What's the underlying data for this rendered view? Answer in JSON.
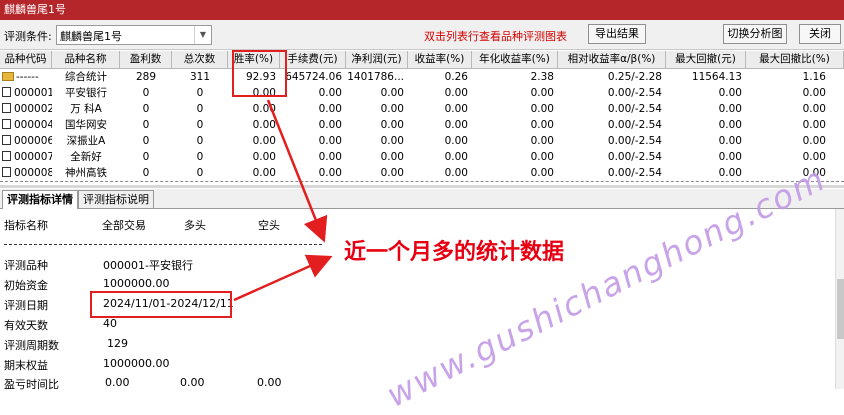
{
  "window": {
    "title": "麒麟兽尾1号"
  },
  "toolbar": {
    "label": "评测条件:",
    "condition_value": "麒麟兽尾1号",
    "hint": "双击列表行查看品种评测图表",
    "export_label": "导出结果",
    "switch_label": "切换分析图",
    "close_label": "关闭"
  },
  "table": {
    "columns": [
      "品种代码",
      "品种名称",
      "盈利数",
      "总次数",
      "胜率(%)",
      "手续费(元)",
      "净利润(元)",
      "收益率(%)",
      "年化收益率(%)",
      "相对收益率α/β(%)",
      "最大回撤(元)",
      "最大回撤比(%)"
    ],
    "summary": [
      "------",
      "综合统计",
      "289",
      "311",
      "92.93",
      "645724.06",
      "1401786...",
      "0.26",
      "2.38",
      "0.25/-2.28",
      "11564.13",
      "1.16"
    ],
    "rows": [
      [
        "000001",
        "平安银行",
        "0",
        "0",
        "0.00",
        "0.00",
        "0.00",
        "0.00",
        "0.00",
        "0.00/-2.54",
        "0.00",
        "0.00"
      ],
      [
        "000002",
        "万 科A",
        "0",
        "0",
        "0.00",
        "0.00",
        "0.00",
        "0.00",
        "0.00",
        "0.00/-2.54",
        "0.00",
        "0.00"
      ],
      [
        "000004",
        "国华网安",
        "0",
        "0",
        "0.00",
        "0.00",
        "0.00",
        "0.00",
        "0.00",
        "0.00/-2.54",
        "0.00",
        "0.00"
      ],
      [
        "000006",
        "深振业A",
        "0",
        "0",
        "0.00",
        "0.00",
        "0.00",
        "0.00",
        "0.00",
        "0.00/-2.54",
        "0.00",
        "0.00"
      ],
      [
        "000007",
        "全新好",
        "0",
        "0",
        "0.00",
        "0.00",
        "0.00",
        "0.00",
        "0.00",
        "0.00/-2.54",
        "0.00",
        "0.00"
      ],
      [
        "000008",
        "神州高铁",
        "0",
        "0",
        "0.00",
        "0.00",
        "0.00",
        "0.00",
        "0.00",
        "0.00/-2.54",
        "0.00",
        "0.00"
      ]
    ]
  },
  "tabs": [
    "评测指标详情",
    "评测指标说明"
  ],
  "details": {
    "headers": [
      "指标名称",
      "全部交易",
      "多头",
      "空头"
    ],
    "items": [
      {
        "label": "评测品种",
        "value": "000001-平安银行"
      },
      {
        "label": "初始资金",
        "value": "1000000.00"
      },
      {
        "label": "评测日期",
        "value": "2024/11/01-2024/12/11"
      },
      {
        "label": "有效天数",
        "value": "40"
      },
      {
        "label": "评测周期数",
        "value": "129"
      },
      {
        "label": "期末权益",
        "value": "1000000.00"
      }
    ],
    "partial_label": "盈亏时间比",
    "partial_values": [
      "0.00",
      "0.00",
      "0.00"
    ]
  },
  "annotation": {
    "text": "近一个月多的统计数据",
    "color": "#e60012"
  },
  "watermark": {
    "text": "www.gushichanghong.com",
    "color": "#c39ae6"
  },
  "colors": {
    "titlebar": "#b5262b",
    "highlight_box": "#e31e1e",
    "hint_text": "#d40000"
  }
}
